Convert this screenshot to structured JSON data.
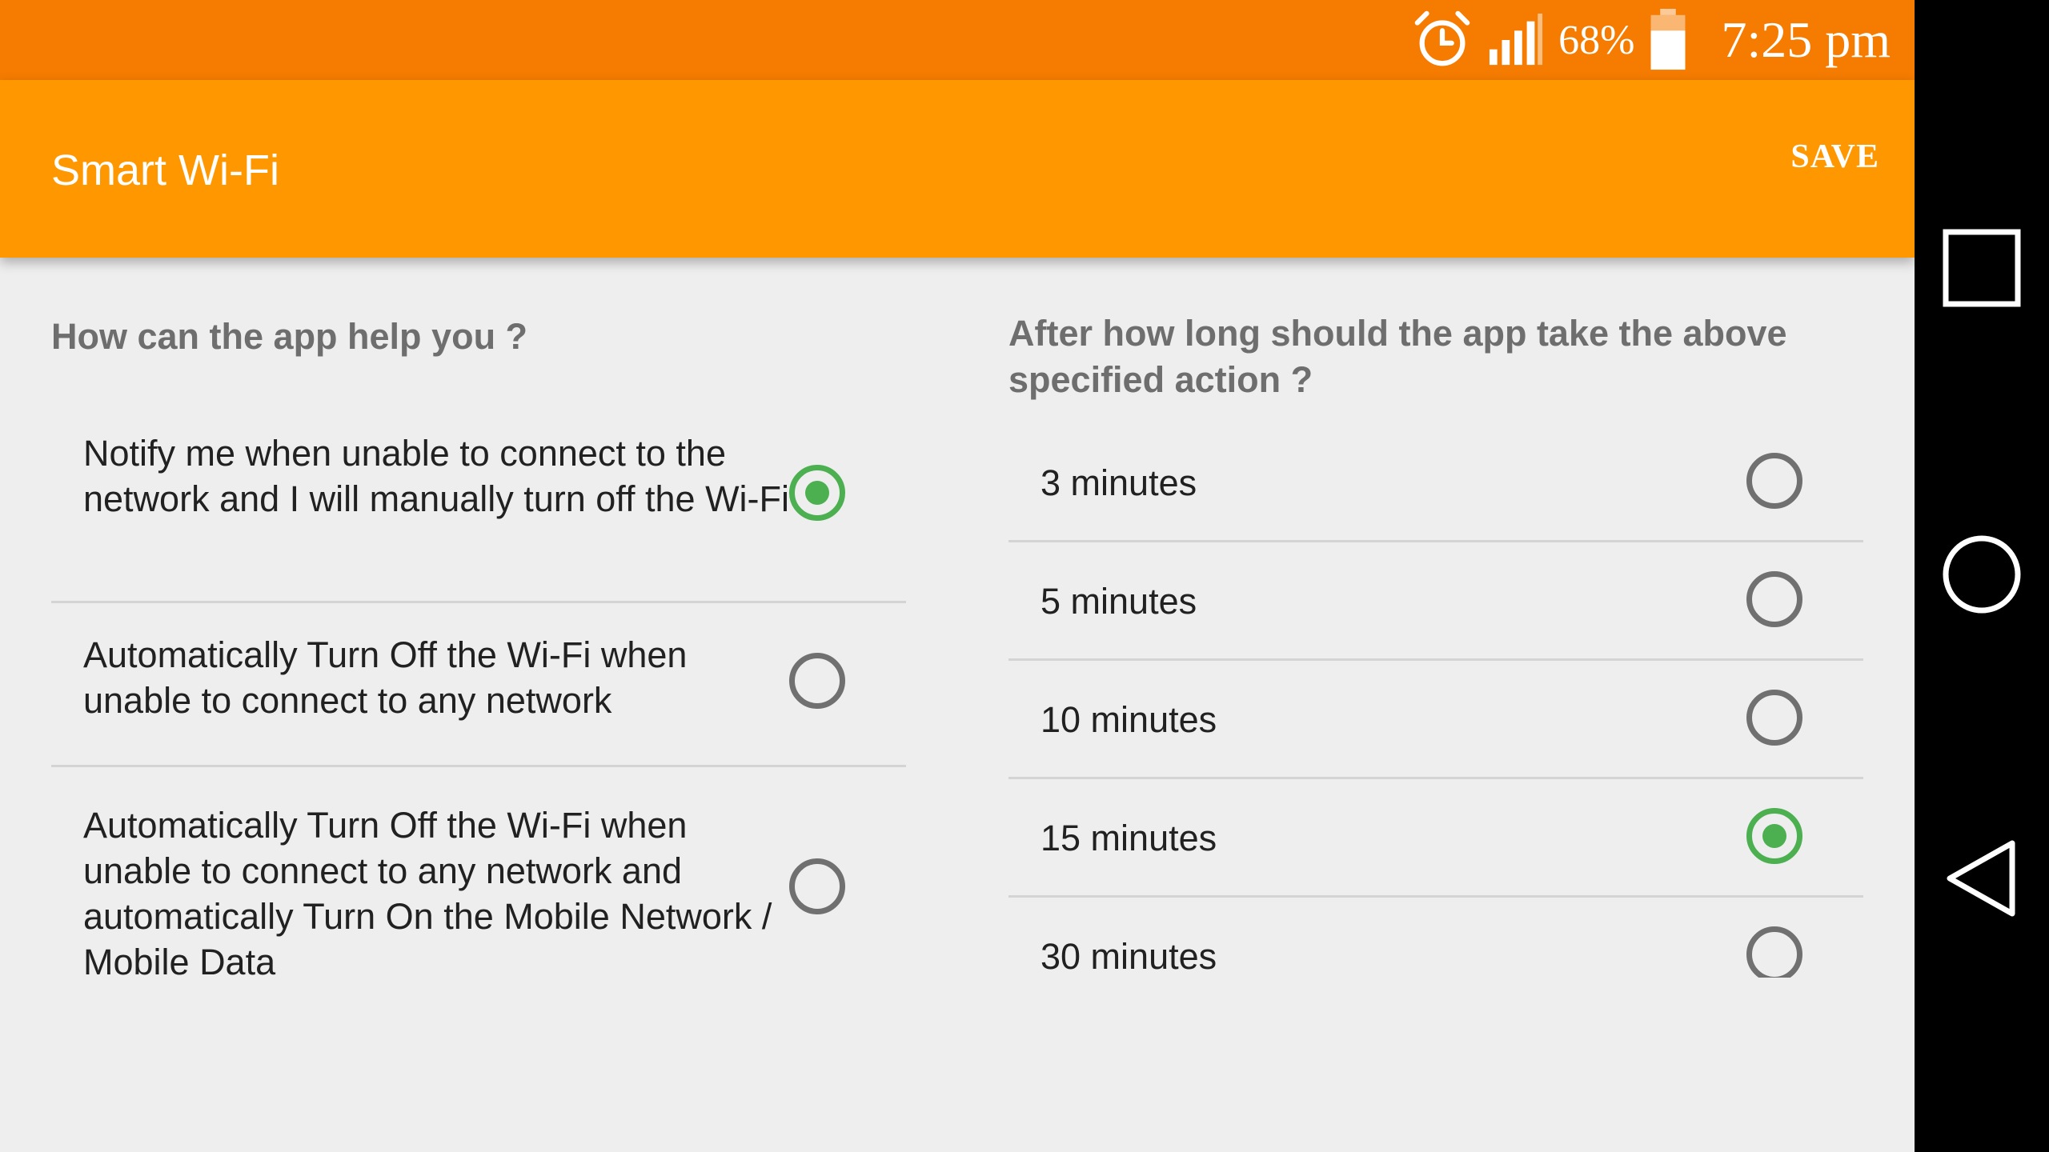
{
  "status_bar": {
    "alarm_icon": "alarm-clock-icon",
    "signal_icon": "cell-signal-icon",
    "battery_icon": "battery-icon",
    "battery_percent": "68%",
    "time": "7:25 pm",
    "background_color": "#f57c00"
  },
  "app_bar": {
    "title": "Smart Wi-Fi",
    "save_label": "SAVE",
    "background_color": "#ff9800"
  },
  "help_section": {
    "title": "How can the app help you ?",
    "options": [
      {
        "label": "Notify me when unable to connect to the network and I will manually turn off the Wi-Fi",
        "selected": true
      },
      {
        "label": "Automatically Turn Off the Wi-Fi when unable to connect to any network",
        "selected": false
      },
      {
        "label": "Automatically Turn Off the Wi-Fi when unable to connect to any network and automatically Turn On the Mobile Network / Mobile Data",
        "selected": false
      }
    ]
  },
  "delay_section": {
    "title": "After how long should the app take the above specified action ?",
    "options": [
      {
        "label": "3 minutes",
        "selected": false
      },
      {
        "label": "5 minutes",
        "selected": false
      },
      {
        "label": "10 minutes",
        "selected": false
      },
      {
        "label": "15 minutes",
        "selected": true
      },
      {
        "label": "30 minutes",
        "selected": false
      }
    ]
  },
  "nav_bar": {
    "recents_icon": "recents-square-icon",
    "home_icon": "home-circle-icon",
    "back_icon": "back-triangle-icon"
  },
  "colors": {
    "accent_selected": "#4caf50",
    "radio_unselected": "#707070",
    "background": "#eeeeee"
  }
}
